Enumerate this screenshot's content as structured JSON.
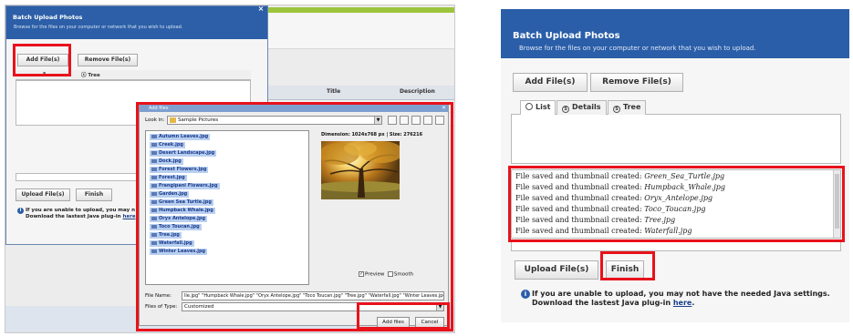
{
  "left": {
    "bg_table": {
      "title_header": "Title",
      "description_header": "Description"
    },
    "dialog": {
      "title": "Batch Upload Photos",
      "subtitle": "Browse for the files on your computer or network that you wish to upload.",
      "close_symbol": "×",
      "add_button": "Add File(s)",
      "remove_button": "Remove File(s)",
      "tab_details": "s",
      "tab_tree": "Tree",
      "upload_button": "Upload File(s)",
      "finish_button": "Finish",
      "note_line1": "If you are unable to upload, you may n",
      "note_line2_prefix": "Download the lastest Java plug-in",
      "note_link": "here"
    },
    "add_files": {
      "title": "Add files",
      "look_in_label": "Look in:",
      "look_in_value": "Sample Pictures",
      "files": [
        "Autumn Leaves.jpg",
        "Creek.jpg",
        "Desert Landscape.jpg",
        "Dock.jpg",
        "Forest Flowers.jpg",
        "Forest.jpg",
        "Frangipani Flowers.jpg",
        "Garden.jpg",
        "Green Sea Turtle.jpg",
        "Humpback Whale.jpg",
        "Oryx Antelope.jpg",
        "Toco Toucan.jpg",
        "Tree.jpg",
        "Waterfall.jpg",
        "Winter Leaves.jpg"
      ],
      "dimension_text": "Dimension: 1024x768 px | Size: 276216",
      "preview_label": "Preview",
      "smooth_label": "Smooth",
      "preview_checked": true,
      "smooth_checked": false,
      "file_name_label": "File Name:",
      "file_name_value": "lle.jpg\" \"Humpback Whale.jpg\" \"Oryx Antelope.jpg\" \"Toco Toucan.jpg\" \"Tree.jpg\" \"Waterfall.jpg\" \"Winter Leaves.jpg\"",
      "files_of_type_label": "Files of Type:",
      "files_of_type_value": "Customized",
      "add_files_button": "Add files",
      "cancel_button": "Cancel"
    }
  },
  "right": {
    "title": "Batch Upload Photos",
    "subtitle": "Browse for the files on your computer or network that you wish to upload.",
    "add_button": "Add File(s)",
    "remove_button": "Remove File(s)",
    "tabs": [
      "List",
      "Details",
      "Tree"
    ],
    "log_prefix": "File saved and thumbnail created:",
    "log_files": [
      "Green_Sea_Turtle.jpg",
      "Humpback_Whale.jpg",
      "Oryx_Antelope.jpg",
      "Toco_Toucan.jpg",
      "Tree.jpg",
      "Waterfall.jpg"
    ],
    "upload_button": "Upload File(s)",
    "finish_button": "Finish",
    "note_line1": "If you are unable to upload, you may not have the needed Java settings.",
    "note_line2_prefix": "Download the lastest Java plug-in",
    "note_link": "here"
  },
  "colors": {
    "header_blue": "#2a5ea8",
    "highlight_red": "#e8121b",
    "selection_blue": "#b8cff0"
  }
}
